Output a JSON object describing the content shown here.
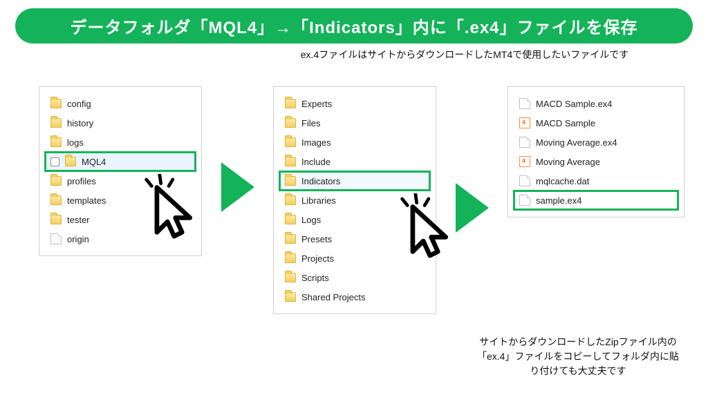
{
  "banner": "データフォルダ「MQL4」→「Indicators」内に「.ex4」ファイルを保存",
  "subline": "ex.4ファイルはサイトからダウンロードしたMT4で使用したいファイルです",
  "panel1": {
    "items": [
      {
        "label": "config",
        "kind": "folder"
      },
      {
        "label": "history",
        "kind": "folder"
      },
      {
        "label": "logs",
        "kind": "folder"
      },
      {
        "label": "MQL4",
        "kind": "folder",
        "selected": true,
        "checkbox": true,
        "highlight": true
      },
      {
        "label": "profiles",
        "kind": "folder"
      },
      {
        "label": "templates",
        "kind": "folder"
      },
      {
        "label": "tester",
        "kind": "folder"
      },
      {
        "label": "origin",
        "kind": "file"
      }
    ]
  },
  "panel2": {
    "items": [
      {
        "label": "Experts",
        "kind": "folder"
      },
      {
        "label": "Files",
        "kind": "folder"
      },
      {
        "label": "Images",
        "kind": "folder"
      },
      {
        "label": "Include",
        "kind": "folder"
      },
      {
        "label": "Indicators",
        "kind": "folder",
        "hover": true,
        "highlight": true
      },
      {
        "label": "Libraries",
        "kind": "folder"
      },
      {
        "label": "Logs",
        "kind": "folder"
      },
      {
        "label": "Presets",
        "kind": "folder"
      },
      {
        "label": "Projects",
        "kind": "folder"
      },
      {
        "label": "Scripts",
        "kind": "folder"
      },
      {
        "label": "Shared Projects",
        "kind": "folder"
      }
    ]
  },
  "panel3": {
    "items": [
      {
        "label": "MACD Sample.ex4",
        "kind": "file"
      },
      {
        "label": "MACD Sample",
        "kind": "code"
      },
      {
        "label": "Moving Average.ex4",
        "kind": "file"
      },
      {
        "label": "Moving Average",
        "kind": "code"
      },
      {
        "label": "mqlcache.dat",
        "kind": "file"
      },
      {
        "label": "sample.ex4",
        "kind": "file",
        "highlight": true
      }
    ]
  },
  "footnote": "サイトからダウンロードしたZipファイル内の「ex.4」ファイルをコピーしてフォルダ内に貼り付けても大丈夫です",
  "colors": {
    "accent": "#14b35a"
  }
}
